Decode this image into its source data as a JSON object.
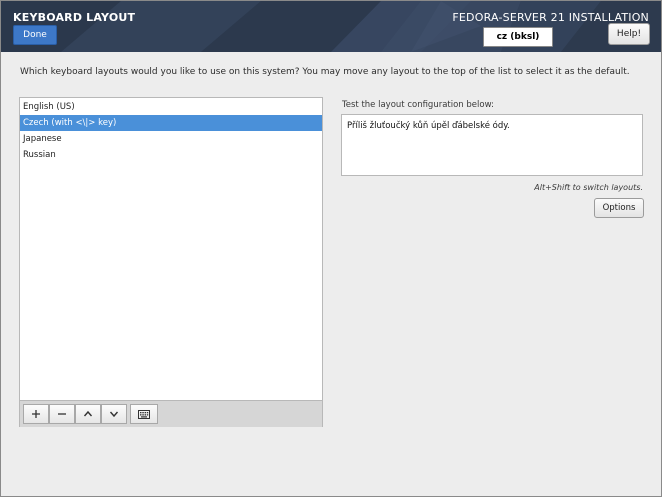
{
  "header": {
    "title": "KEYBOARD LAYOUT",
    "done_label": "Done",
    "product_title": "FEDORA-SERVER 21 INSTALLATION",
    "layout_indicator": "cz (bksl)",
    "help_label": "Help!"
  },
  "main": {
    "instructions": "Which keyboard layouts would you like to use on this system?  You may move any layout to the top of the list to select it as the default.",
    "layouts": [
      {
        "label": "English (US)",
        "selected": false
      },
      {
        "label": "Czech (with <\\|> key)",
        "selected": true
      },
      {
        "label": "Japanese",
        "selected": false
      },
      {
        "label": "Russian",
        "selected": false
      }
    ],
    "toolbar": {
      "add_icon": "plus-icon",
      "remove_icon": "minus-icon",
      "up_icon": "arrow-up-icon",
      "down_icon": "arrow-down-icon",
      "preview_icon": "keyboard-icon"
    },
    "test": {
      "label": "Test the layout configuration below:",
      "value": "Příliš žluťoučký kůň úpěl ďábelské ódy."
    },
    "switch_hint": "Alt+Shift to switch layouts.",
    "options_label": "Options"
  },
  "colors": {
    "header_bg": "#2e3b4f",
    "accent": "#3d78c8",
    "selection": "#4a90d9"
  }
}
